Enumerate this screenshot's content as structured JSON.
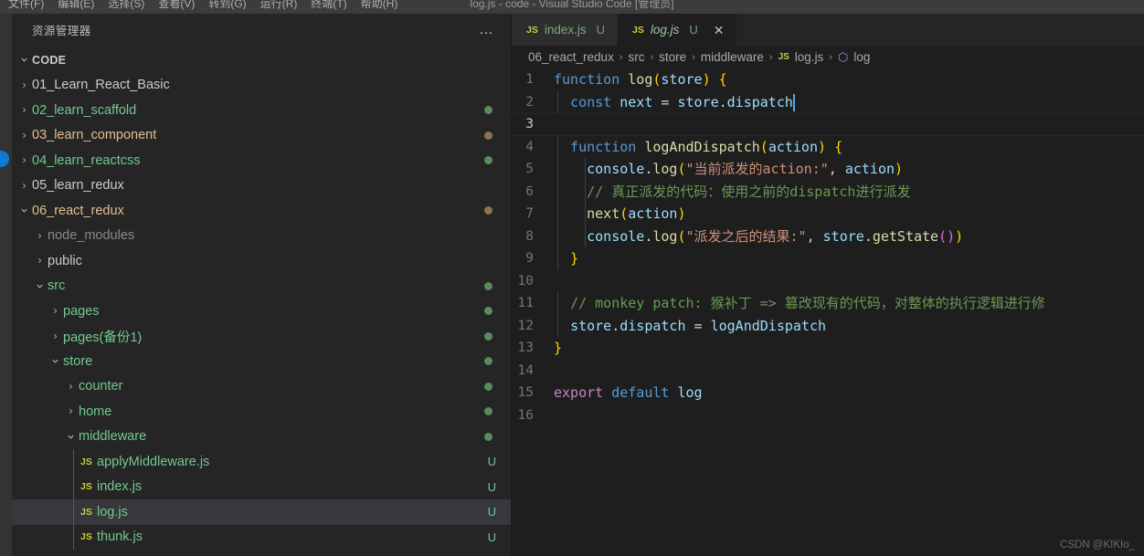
{
  "window": {
    "title": "log.js - code - Visual Studio Code [管理员]",
    "menus": [
      "文件(F)",
      "编辑(E)",
      "选择(S)",
      "查看(V)",
      "转到(G)",
      "运行(R)",
      "终端(T)",
      "帮助(H)"
    ]
  },
  "activity_bar": {
    "badge_color": "#0e7ad4"
  },
  "sidebar": {
    "title": "资源管理器",
    "more_icon": "…",
    "root": {
      "label": "CODE",
      "twisty": "down"
    },
    "tree": [
      {
        "label": "01_Learn_React_Basic",
        "indent": 1,
        "twisty": "right",
        "type": "folder",
        "color": "#cccccc",
        "deco": "",
        "dot": ""
      },
      {
        "label": "02_learn_scaffold",
        "indent": 1,
        "twisty": "right",
        "type": "folder",
        "color": "#73c990",
        "deco": "",
        "dot": "#5a8a5e"
      },
      {
        "label": "03_learn_component",
        "indent": 1,
        "twisty": "right",
        "type": "folder",
        "color": "#e2c08d",
        "deco": "",
        "dot": "#8a7450"
      },
      {
        "label": "04_learn_reactcss",
        "indent": 1,
        "twisty": "right",
        "type": "folder",
        "color": "#73c990",
        "deco": "",
        "dot": "#5a8a5e"
      },
      {
        "label": "05_learn_redux",
        "indent": 1,
        "twisty": "right",
        "type": "folder",
        "color": "#cccccc",
        "deco": "",
        "dot": ""
      },
      {
        "label": "06_react_redux",
        "indent": 1,
        "twisty": "down",
        "type": "folder",
        "color": "#e2c08d",
        "deco": "",
        "dot": "#8a7450"
      },
      {
        "label": "node_modules",
        "indent": 2,
        "twisty": "right",
        "type": "folder",
        "color": "#8a8a8a",
        "deco": "",
        "dot": ""
      },
      {
        "label": "public",
        "indent": 2,
        "twisty": "right",
        "type": "folder",
        "color": "#cccccc",
        "deco": "",
        "dot": ""
      },
      {
        "label": "src",
        "indent": 2,
        "twisty": "down",
        "type": "folder",
        "color": "#73c990",
        "deco": "",
        "dot": "#5a8a5e"
      },
      {
        "label": "pages",
        "indent": 3,
        "twisty": "right",
        "type": "folder",
        "color": "#73c990",
        "deco": "",
        "dot": "#5a8a5e"
      },
      {
        "label": "pages(备份1)",
        "indent": 3,
        "twisty": "right",
        "type": "folder",
        "color": "#73c990",
        "deco": "",
        "dot": "#5a8a5e"
      },
      {
        "label": "store",
        "indent": 3,
        "twisty": "down",
        "type": "folder",
        "color": "#73c990",
        "deco": "",
        "dot": "#5a8a5e"
      },
      {
        "label": "counter",
        "indent": 4,
        "twisty": "right",
        "type": "folder",
        "color": "#73c990",
        "deco": "",
        "dot": "#5a8a5e"
      },
      {
        "label": "home",
        "indent": 4,
        "twisty": "right",
        "type": "folder",
        "color": "#73c990",
        "deco": "",
        "dot": "#5a8a5e"
      },
      {
        "label": "middleware",
        "indent": 4,
        "twisty": "down",
        "type": "folder",
        "color": "#73c990",
        "deco": "",
        "dot": "#5a8a5e"
      },
      {
        "label": "applyMiddleware.js",
        "indent": 5,
        "twisty": "",
        "type": "js",
        "color": "#73c990",
        "deco": "U",
        "dot": ""
      },
      {
        "label": "index.js",
        "indent": 5,
        "twisty": "",
        "type": "js",
        "color": "#73c990",
        "deco": "U",
        "dot": ""
      },
      {
        "label": "log.js",
        "indent": 5,
        "twisty": "",
        "type": "js",
        "color": "#73c990",
        "deco": "U",
        "dot": "",
        "selected": true
      },
      {
        "label": "thunk.js",
        "indent": 5,
        "twisty": "",
        "type": "js",
        "color": "#73c990",
        "deco": "U",
        "dot": ""
      }
    ],
    "js_icon_label": "JS"
  },
  "editor": {
    "tabs": [
      {
        "icon": "JS",
        "name": "index.js",
        "status": "U",
        "active": false,
        "close": ""
      },
      {
        "icon": "JS",
        "name": "log.js",
        "status": "U",
        "active": true,
        "close": "✕"
      }
    ],
    "breadcrumb": {
      "separator": "›",
      "items": [
        "06_react_redux",
        "src",
        "store",
        "middleware"
      ],
      "file_icon": "JS",
      "file": "log.js",
      "symbol_icon": "⬡",
      "symbol": "log"
    },
    "line_numbers": [
      "1",
      "2",
      "3",
      "4",
      "5",
      "6",
      "7",
      "8",
      "9",
      "10",
      "11",
      "12",
      "13",
      "14",
      "15",
      "16"
    ],
    "current_line": 3,
    "code_lines": [
      [
        {
          "t": "function",
          "c": "t-kw"
        },
        {
          "t": " ",
          "c": "t-pl"
        },
        {
          "t": "log",
          "c": "t-fn"
        },
        {
          "t": "(",
          "c": "t-b1"
        },
        {
          "t": "store",
          "c": "t-var"
        },
        {
          "t": ")",
          "c": "t-b1"
        },
        {
          "t": " ",
          "c": "t-pl"
        },
        {
          "t": "{",
          "c": "t-b1"
        }
      ],
      [
        {
          "t": "  ",
          "c": "t-pl"
        },
        {
          "t": "const",
          "c": "t-kw"
        },
        {
          "t": " ",
          "c": "t-pl"
        },
        {
          "t": "next",
          "c": "t-var"
        },
        {
          "t": " ",
          "c": "t-pl"
        },
        {
          "t": "=",
          "c": "t-op"
        },
        {
          "t": " ",
          "c": "t-pl"
        },
        {
          "t": "store",
          "c": "t-var"
        },
        {
          "t": ".",
          "c": "t-op"
        },
        {
          "t": "dispatch",
          "c": "t-var"
        }
      ],
      [],
      [
        {
          "t": "  ",
          "c": "t-pl"
        },
        {
          "t": "function",
          "c": "t-kw"
        },
        {
          "t": " ",
          "c": "t-pl"
        },
        {
          "t": "logAndDispatch",
          "c": "t-fn"
        },
        {
          "t": "(",
          "c": "t-b1"
        },
        {
          "t": "action",
          "c": "t-var"
        },
        {
          "t": ")",
          "c": "t-b1"
        },
        {
          "t": " ",
          "c": "t-pl"
        },
        {
          "t": "{",
          "c": "t-b1"
        }
      ],
      [
        {
          "t": "    ",
          "c": "t-pl"
        },
        {
          "t": "console",
          "c": "t-var"
        },
        {
          "t": ".",
          "c": "t-op"
        },
        {
          "t": "log",
          "c": "t-fn"
        },
        {
          "t": "(",
          "c": "t-b1"
        },
        {
          "t": "\"当前派发的action:\"",
          "c": "t-str"
        },
        {
          "t": ",",
          "c": "t-op"
        },
        {
          "t": " ",
          "c": "t-pl"
        },
        {
          "t": "action",
          "c": "t-var"
        },
        {
          "t": ")",
          "c": "t-b1"
        }
      ],
      [
        {
          "t": "    ",
          "c": "t-pl"
        },
        {
          "t": "// 真正派发的代码：使用之前的dispatch进行派发",
          "c": "t-cmt"
        }
      ],
      [
        {
          "t": "    ",
          "c": "t-pl"
        },
        {
          "t": "next",
          "c": "t-fn"
        },
        {
          "t": "(",
          "c": "t-b1"
        },
        {
          "t": "action",
          "c": "t-var"
        },
        {
          "t": ")",
          "c": "t-b1"
        }
      ],
      [
        {
          "t": "    ",
          "c": "t-pl"
        },
        {
          "t": "console",
          "c": "t-var"
        },
        {
          "t": ".",
          "c": "t-op"
        },
        {
          "t": "log",
          "c": "t-fn"
        },
        {
          "t": "(",
          "c": "t-b1"
        },
        {
          "t": "\"派发之后的结果:\"",
          "c": "t-str"
        },
        {
          "t": ",",
          "c": "t-op"
        },
        {
          "t": " ",
          "c": "t-pl"
        },
        {
          "t": "store",
          "c": "t-var"
        },
        {
          "t": ".",
          "c": "t-op"
        },
        {
          "t": "getState",
          "c": "t-fn"
        },
        {
          "t": "(",
          "c": "t-b2"
        },
        {
          "t": ")",
          "c": "t-b2"
        },
        {
          "t": ")",
          "c": "t-b1"
        }
      ],
      [
        {
          "t": "  ",
          "c": "t-pl"
        },
        {
          "t": "}",
          "c": "t-b1"
        }
      ],
      [],
      [
        {
          "t": "  ",
          "c": "t-pl"
        },
        {
          "t": "// monkey patch: 猴补丁 => 篡改现有的代码，对整体的执行逻辑进行修",
          "c": "t-cmt"
        }
      ],
      [
        {
          "t": "  ",
          "c": "t-pl"
        },
        {
          "t": "store",
          "c": "t-var"
        },
        {
          "t": ".",
          "c": "t-op"
        },
        {
          "t": "dispatch",
          "c": "t-var"
        },
        {
          "t": " ",
          "c": "t-pl"
        },
        {
          "t": "=",
          "c": "t-op"
        },
        {
          "t": " ",
          "c": "t-pl"
        },
        {
          "t": "logAndDispatch",
          "c": "t-var"
        }
      ],
      [
        {
          "t": "}",
          "c": "t-b1"
        }
      ],
      [],
      [
        {
          "t": "export",
          "c": "t-kw2"
        },
        {
          "t": " ",
          "c": "t-pl"
        },
        {
          "t": "default",
          "c": "t-kw"
        },
        {
          "t": " ",
          "c": "t-pl"
        },
        {
          "t": "log",
          "c": "t-var"
        }
      ],
      []
    ]
  },
  "watermark": "CSDN @KIKIo_"
}
